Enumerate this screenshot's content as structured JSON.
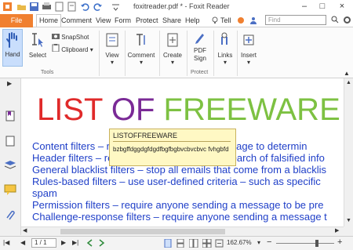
{
  "window": {
    "title": "foxitreader.pdf * - Foxit Reader",
    "tell_me": "Tell"
  },
  "ribbon_tabs": [
    "File",
    "Home",
    "Comment",
    "View",
    "Form",
    "Protect",
    "Share",
    "Help"
  ],
  "search": {
    "placeholder": "Find"
  },
  "ribbon": {
    "hand": "Hand",
    "select": "Select",
    "snapshot": "SnapShot",
    "clipboard": "Clipboard",
    "view": "View",
    "comment": "Comment",
    "create": "Create",
    "pdf_sign_1": "PDF",
    "pdf_sign_2": "Sign",
    "links": "Links",
    "insert": "Insert",
    "group_tools": "Tools",
    "group_protect": "Protect"
  },
  "document": {
    "heading_w1": "LIST",
    "heading_w2": "OF",
    "heading_w3": "FREEWARE",
    "lines": [
      "Content filters – review the content of a message to determin",
      "Header filters – review the email header in search of falsified info",
      "General blacklist filters – stop all emails that come from a blacklis",
      "Rules-based filters – use user-defined criteria – such as specific",
      "spam",
      "Permission filters – require anyone sending a message to be pre",
      "Challenge-response filters – require anyone sending a message t"
    ]
  },
  "popup_note": {
    "title": "LISTOFFREEWARE",
    "body": "bzbgffdggdgfdgdfbgfbgbvcbvcbvc fvhgbfd"
  },
  "status": {
    "page": "1 / 1",
    "zoom": "162.67%"
  },
  "colors": {
    "file_tab": "#f08030",
    "heading_list": "#e02a2a",
    "heading_of": "#7a2a96",
    "heading_freeware": "#7dc142",
    "body_text": "#1f3fc8",
    "note_bg": "#fff8c4"
  }
}
